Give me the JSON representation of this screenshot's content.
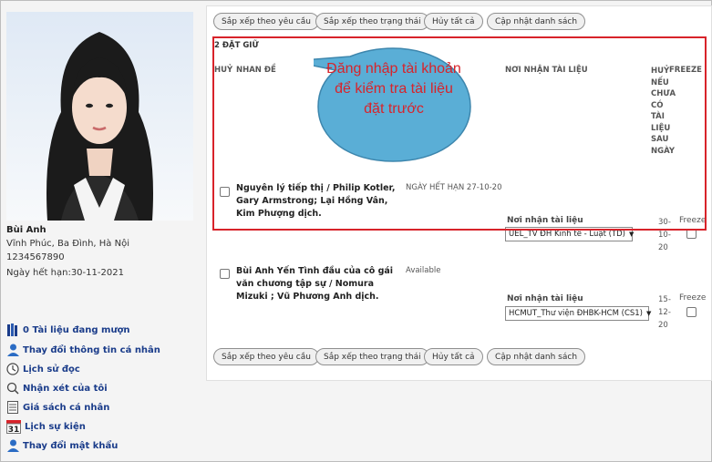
{
  "profile": {
    "name": "Bùi Anh",
    "address": "Vĩnh Phúc, Ba Đình, Hà Nội",
    "phone": "1234567890",
    "expiry": "Ngày hết hạn:30-11-2021"
  },
  "menu": [
    {
      "label": "0 Tài liệu đang mượn",
      "icon": "books-icon"
    },
    {
      "label": "Thay đổi thông tin cá nhân",
      "icon": "user-icon"
    },
    {
      "label": "Lịch sử đọc",
      "icon": "clock-icon"
    },
    {
      "label": "Nhận xét của tôi",
      "icon": "search-icon"
    },
    {
      "label": "Giá sách cá nhân",
      "icon": "list-icon"
    },
    {
      "label": "Lịch sự kiện",
      "icon": "calendar-icon",
      "calendar_day": "31"
    },
    {
      "label": "Thay đổi mật khẩu",
      "icon": "user-icon"
    }
  ],
  "toolbar": {
    "sort_request": "Sắp xếp theo yêu cầu",
    "sort_status": "Sắp xếp theo trạng thái",
    "cancel_all": "Hủy tất cả",
    "update_list": "Cập nhật danh sách"
  },
  "holds": {
    "section_title": "2 ĐẶT GIỮ",
    "headers": {
      "cancel": "HUỶ",
      "title": "NHAN ĐỀ",
      "pickup": "NƠI NHẬN TÀI LIỆU",
      "cancel_if": "HUỶ NẾU CHƯA CÓ TÀI LIỆU SAU NGÀY",
      "freeze": "FREEZE"
    },
    "items": [
      {
        "title": "Nguyên lý tiếp thị / Philip Kotler, Gary Armstrong; Lại Hồng Vân, Kim Phượng dịch.",
        "status": "NGÀY HẾT HẠN 27-10-20",
        "pickup_label": "Nơi nhận tài liệu",
        "pickup_value": "UEL_TV ĐH Kinh tế - Luật (TD)",
        "date": "30-10-20",
        "freeze_label": "Freeze"
      },
      {
        "title": "Bùi Anh Yến Tình đầu của cô gái văn chương tập sự / Nomura Mizuki ; Vũ Phương Anh dịch.",
        "status": "Available",
        "pickup_label": "Nơi nhận tài liệu",
        "pickup_value": "HCMUT_Thư viện ĐHBK-HCM (CS1)",
        "date": "15-12-20",
        "freeze_label": "Freeze"
      }
    ]
  },
  "callout": "Đăng nhập tài khoản để kiểm tra tài liệu đặt trước",
  "colors": {
    "accent_red": "#d8232a",
    "bubble_fill": "#5aaed6",
    "link_blue": "#1a3c8a"
  }
}
